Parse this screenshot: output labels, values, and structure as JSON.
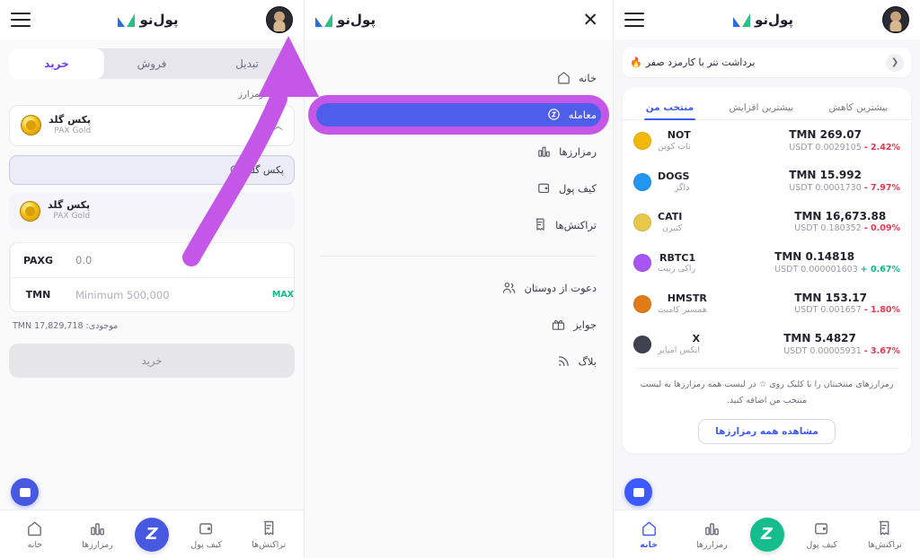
{
  "app": {
    "logo_text": "پول‌نو",
    "accent_blue": "#3d5afe",
    "accent_purple": "#6a3df0",
    "annotation_purple": "#c456e8",
    "green": "#15bd8d",
    "down_red": "#e8384f",
    "up_green": "#12b886"
  },
  "left_panel": {
    "banner": {
      "text": "برداشت تتر با کارمزد صفر",
      "emoji": "🔥",
      "nav_glyph": "❮"
    },
    "tabs": [
      {
        "label": "بیشترین کاهش",
        "active": false
      },
      {
        "label": "بیشترین افزایش",
        "active": false
      },
      {
        "label": "منتخب من",
        "active": true
      }
    ],
    "coins": [
      {
        "symbol": "NOT",
        "name_fa": "نات کوین",
        "price": "TMN 269.07",
        "usdt": "USDT 0.0029105",
        "change": "- 2.42%",
        "dir": "down",
        "color": "#f0b90b"
      },
      {
        "symbol": "DOGS",
        "name_fa": "داگز",
        "price": "TMN 15.992",
        "usdt": "USDT 0.0001730",
        "change": "- 7.97%",
        "dir": "down",
        "color": "#2196f3"
      },
      {
        "symbol": "CATI",
        "name_fa": "کتیزن",
        "price": "TMN 16,673.88",
        "usdt": "USDT 0.180352",
        "change": "- 0.09%",
        "dir": "down",
        "color": "#e8c84a"
      },
      {
        "symbol": "RBTC1",
        "name_fa": "راکی ربیت",
        "price": "TMN 0.14818",
        "usdt": "USDT 0.000001603",
        "change": "+ 0.67%",
        "dir": "up",
        "color": "#a855f7"
      },
      {
        "symbol": "HMSTR",
        "name_fa": "همستر کامبت",
        "price": "TMN 153.17",
        "usdt": "USDT 0.001657",
        "change": "- 1.80%",
        "dir": "down",
        "color": "#e07b18"
      },
      {
        "symbol": "X",
        "name_fa": "ایکس امپایر",
        "price": "TMN 5.4827",
        "usdt": "USDT 0.00005931",
        "change": "- 3.67%",
        "dir": "down",
        "color": "#3f4350"
      }
    ],
    "note_line1": "رمزارزهای منتخبتان را با کلیک روی ☆ در لیست همه رمزارزها به لیست",
    "note_line2": "منتخب من اضافه کنید.",
    "see_all_label": "مشاهده همه رمزارزها"
  },
  "mid_panel": {
    "close_glyph": "✕",
    "menu": [
      {
        "label": "خانه",
        "icon": "home-icon",
        "highlighted": false
      },
      {
        "label": "معامله",
        "icon": "trade-icon",
        "highlighted": true
      },
      {
        "label": "رمزارزها",
        "icon": "chart-bars-icon",
        "highlighted": false
      },
      {
        "label": "کیف پول",
        "icon": "wallet-icon",
        "highlighted": false
      },
      {
        "label": "تراکنش‌ها",
        "icon": "receipt-icon",
        "highlighted": false
      }
    ],
    "menu_secondary": [
      {
        "label": "دعوت از دوستان",
        "icon": "users-icon"
      },
      {
        "label": "جوایز",
        "icon": "gift-icon"
      },
      {
        "label": "بلاگ",
        "icon": "rss-icon"
      }
    ]
  },
  "right_panel": {
    "tabs": [
      {
        "label": "تبدیل",
        "active": false
      },
      {
        "label": "فروش",
        "active": false
      },
      {
        "label": "خرید",
        "active": true
      }
    ],
    "select_label": "انتخاب رمزارز",
    "selected": {
      "name_fa": "پکس گلد",
      "name_en": "PAX Gold",
      "chevron": "︿"
    },
    "search_value": "پکس گلد",
    "results": [
      {
        "name_fa": "پکس گلد",
        "name_en": "PAX Gold"
      }
    ],
    "amounts": [
      {
        "unit": "PAXG",
        "value": "0.0",
        "max": null
      },
      {
        "unit": "TMN",
        "value": "Minimum 500,000",
        "max": "MAX"
      }
    ],
    "balance": "موجودی: TMN 17,829,718",
    "submit_label": "خرید"
  },
  "bottom_nav": {
    "items": [
      {
        "label": "تراکنش‌ها",
        "icon": "receipt-icon",
        "active": false
      },
      {
        "label": "کیف پول",
        "icon": "wallet-icon",
        "active": false
      },
      {
        "label": "",
        "icon": "brand-z-icon",
        "active": false,
        "center": true
      },
      {
        "label": "رمزارزها",
        "icon": "chart-bars-icon",
        "active": false
      },
      {
        "label": "خانه",
        "icon": "home-icon",
        "active": true
      }
    ],
    "brand_letter": "Z"
  },
  "bottom_nav_right": {
    "items": [
      {
        "label": "تراکنش‌ها",
        "icon": "receipt-icon",
        "active": false
      },
      {
        "label": "کیف پول",
        "icon": "wallet-icon",
        "active": false
      },
      {
        "label": "",
        "icon": "brand-z-icon",
        "active": false,
        "center": true
      },
      {
        "label": "رمزارزها",
        "icon": "chart-bars-icon",
        "active": false
      },
      {
        "label": "خانه",
        "icon": "home-icon",
        "active": false
      }
    ]
  }
}
